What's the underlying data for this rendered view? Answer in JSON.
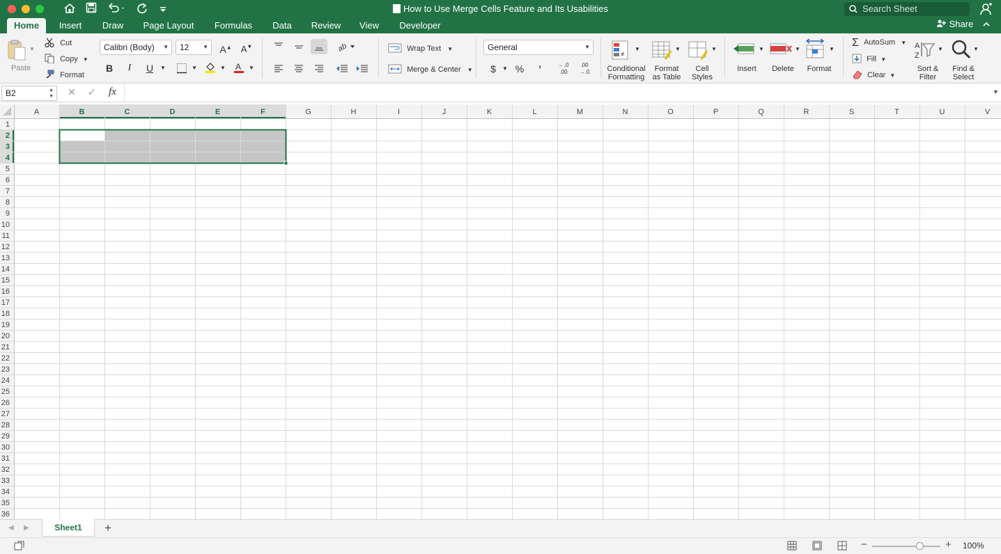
{
  "window": {
    "title": "How to Use Merge Cells Feature and Its Usabilities",
    "search_placeholder": "Search Sheet"
  },
  "ribbon_tabs": [
    {
      "label": "Home",
      "active": true
    },
    {
      "label": "Insert"
    },
    {
      "label": "Draw"
    },
    {
      "label": "Page Layout"
    },
    {
      "label": "Formulas"
    },
    {
      "label": "Data"
    },
    {
      "label": "Review"
    },
    {
      "label": "View"
    },
    {
      "label": "Developer"
    }
  ],
  "share_label": "Share",
  "clipboard": {
    "paste": "Paste",
    "cut": "Cut",
    "copy": "Copy",
    "format": "Format"
  },
  "font": {
    "name": "Calibri (Body)",
    "size": "12",
    "bold": "B",
    "italic": "I",
    "underline": "U"
  },
  "alignment": {
    "wrap_text": "Wrap Text",
    "merge_center": "Merge & Center"
  },
  "number": {
    "format": "General",
    "currency": "$",
    "percent": "%",
    "comma": "’",
    "inc_decimal": ".00",
    "dec_decimal": ".0"
  },
  "styles": {
    "conditional_1": "Conditional",
    "conditional_2": "Formatting",
    "format_table_1": "Format",
    "format_table_2": "as Table",
    "cell_styles_1": "Cell",
    "cell_styles_2": "Styles"
  },
  "cells": {
    "insert": "Insert",
    "delete": "Delete",
    "format": "Format"
  },
  "editing": {
    "autosum": "AutoSum",
    "fill": "Fill",
    "clear": "Clear",
    "sort_1": "Sort &",
    "sort_2": "Filter",
    "find_1": "Find &",
    "find_2": "Select"
  },
  "formula_bar": {
    "name_box": "B2",
    "fx": "fx",
    "formula": ""
  },
  "grid": {
    "columns": [
      "A",
      "B",
      "C",
      "D",
      "E",
      "F",
      "G",
      "H",
      "I",
      "J",
      "K",
      "L",
      "M",
      "N",
      "O",
      "P",
      "Q",
      "R",
      "S",
      "T",
      "U",
      "V"
    ],
    "selected_columns": [
      "B",
      "C",
      "D",
      "E",
      "F"
    ],
    "row_count": 36,
    "selected_rows": [
      2,
      3,
      4
    ],
    "active_cell": "B2",
    "selection_range": "B2:F4"
  },
  "sheets": [
    {
      "label": "Sheet1",
      "active": true
    }
  ],
  "add_sheet": "+",
  "status": {
    "zoom": "100%",
    "zoom_value": 100
  }
}
